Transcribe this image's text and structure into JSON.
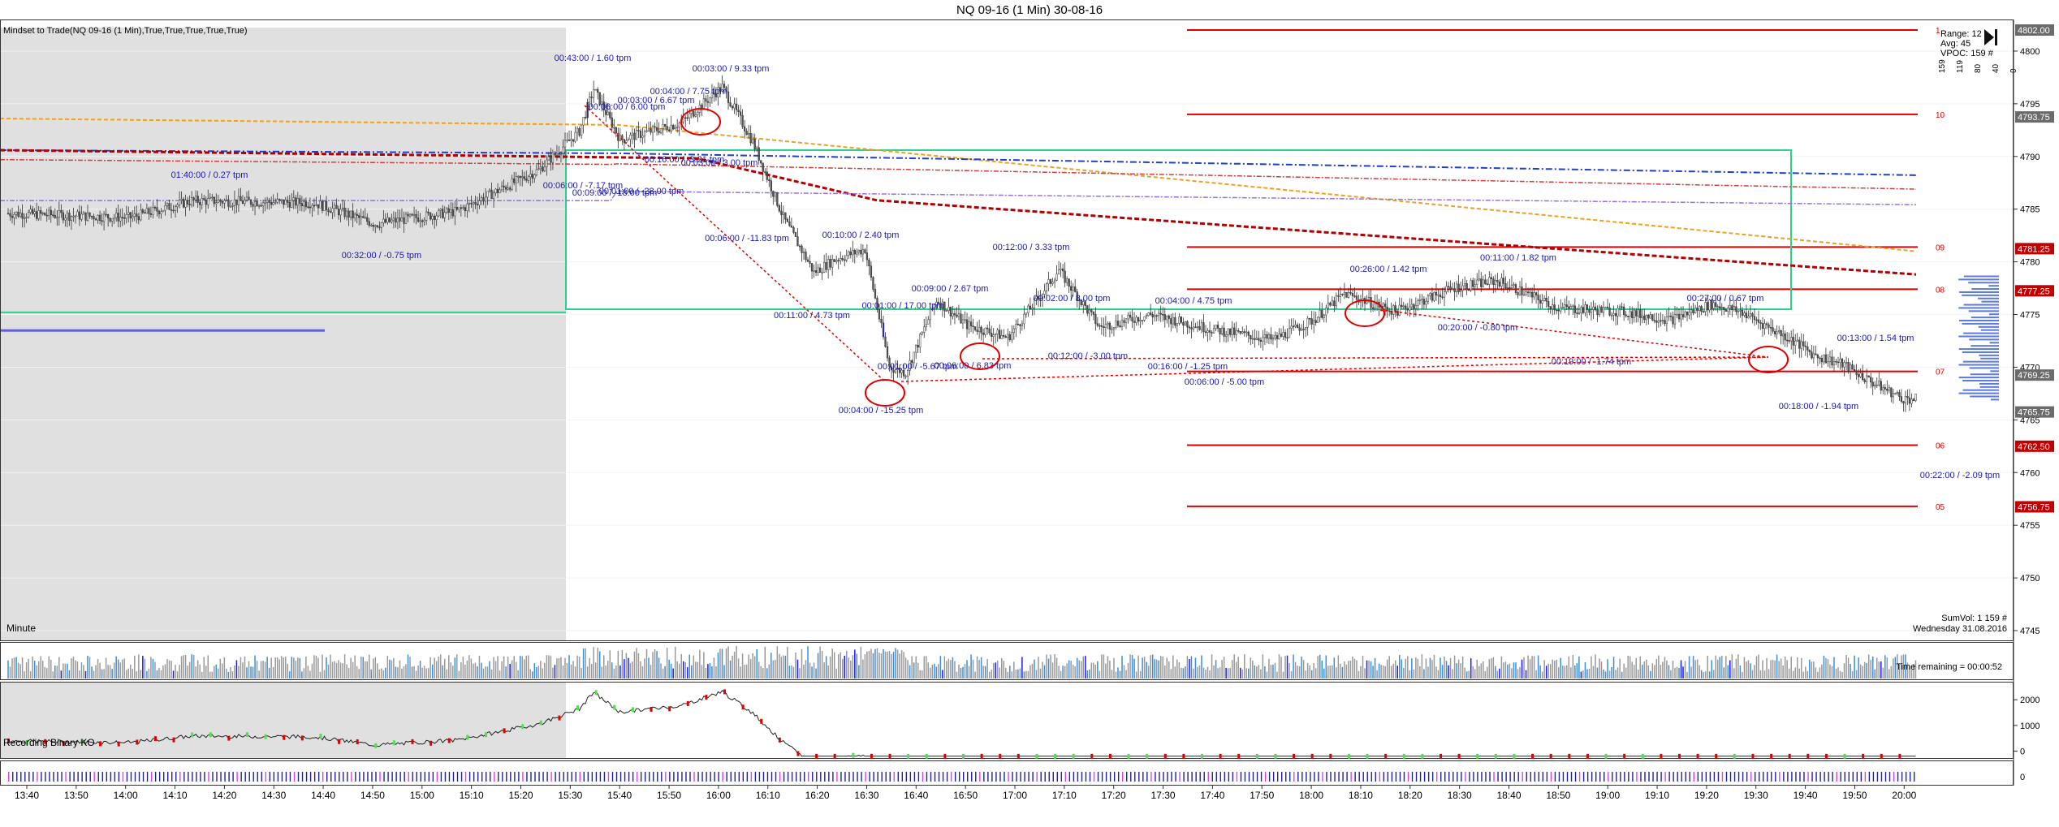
{
  "header": {
    "title": "NQ 09-16 (1 Min)  30-08-16"
  },
  "indicator_label": "Mindset to Trade(NQ 09-16 (1 Min),True,True,True,True,True)",
  "period_label": "Minute",
  "recording_label": "Recording Binary KO",
  "info_box": {
    "range": "Range: 12",
    "avg": "Avg:   45",
    "vpoc": "VPOC: 159 #"
  },
  "sumvol": "SumVol: 1 159 #",
  "date_label": "Wednesday  31.08.2016",
  "time_remaining": "Time remaining = 00:00:52",
  "volume_col_labels": [
    "159",
    "119",
    "80",
    "40",
    "0"
  ],
  "chart_data": [
    {
      "type": "candlestick",
      "title": "NQ 09-16 (1 Min)  30-08-16",
      "x_ticks": [
        "13:40",
        "13:50",
        "14:00",
        "14:10",
        "14:20",
        "14:30",
        "14:40",
        "14:50",
        "15:00",
        "15:10",
        "15:20",
        "15:30",
        "15:40",
        "15:50",
        "16:00",
        "16:10",
        "16:20",
        "16:30",
        "16:40",
        "16:50",
        "17:00",
        "17:10",
        "17:20",
        "17:30",
        "17:40",
        "17:50",
        "18:00",
        "18:10",
        "18:20",
        "18:30",
        "18:40",
        "18:50",
        "19:00",
        "19:10",
        "19:20",
        "19:30",
        "19:40",
        "19:50",
        "20:00"
      ],
      "y_ticks": [
        4800,
        4795,
        4790,
        4785,
        4780,
        4775,
        4770,
        4765,
        4760,
        4755,
        4750,
        4745
      ],
      "ylim": [
        4744,
        4803
      ],
      "price_badges": [
        {
          "label": "4802.00",
          "value": 4802.0,
          "color": "#6b6b6b"
        },
        {
          "label": "4793.75",
          "value": 4793.75,
          "color": "#6b6b6b"
        },
        {
          "label": "4781.25",
          "value": 4781.25,
          "color": "#c00000"
        },
        {
          "label": "4777.25",
          "value": 4777.25,
          "color": "#c00000"
        },
        {
          "label": "4769.25",
          "value": 4769.25,
          "color": "#6b6b6b"
        },
        {
          "label": "4765.75",
          "value": 4765.75,
          "color": "#6b6b6b"
        },
        {
          "label": "4762.50",
          "value": 4762.5,
          "color": "#c00000"
        },
        {
          "label": "4756.75",
          "value": 4756.75,
          "color": "#c00000"
        }
      ],
      "level_lines": [
        {
          "label": "1",
          "value": 4802.0
        },
        {
          "label": "10",
          "value": 4794.0
        },
        {
          "label": "09",
          "value": 4781.4
        },
        {
          "label": "08",
          "value": 4777.4
        },
        {
          "label": "07",
          "value": 4769.6
        },
        {
          "label": "06",
          "value": 4762.6
        },
        {
          "label": "05",
          "value": 4756.8
        }
      ],
      "annotations": [
        "00:43:00 / 1.60 tpm",
        "00:03:00 / 9.33 tpm",
        "00:04:00 / 7.75 tpm",
        "00:03:00 / 6.67 tpm",
        "00:06:00 / 6.00 tpm",
        "01:40:00 / 0.27 tpm",
        "00:06:00 / -7.17 tpm",
        "00:09:00 / -18.00 tpm",
        "00:16:00 / -3.31 tpm",
        "00:03:00 / 3.00 tpm",
        "00:01:00 / -28.00 tpm",
        "00:32:00 / -0.75 tpm",
        "00:06:00 / -11.83 tpm",
        "00:10:00 / 2.40 tpm",
        "00:11:00 / 4.73 tpm",
        "00:01:00 / 17.00 tpm",
        "00:09:00 / 2.67 tpm",
        "00:12:00 / 3.33 tpm",
        "00:01:00 / -5.67 tpm",
        "00:06:00 / 6.83 tpm",
        "00:04:00 / -15.25 tpm",
        "00:02:00 / 8.00 tpm",
        "00:12:00 / -3.00 tpm",
        "00:04:00 / 4.75 tpm",
        "00:16:00 / -1.25 tpm",
        "00:06:00 / -5.00 tpm",
        "00:26:00 / 1.42 tpm",
        "00:11:00 / 1.82 tpm",
        "00:20:00 / -0.80 tpm",
        "00:19:00 / -1.74 tpm",
        "00:27:00 / 0.67 tpm",
        "00:13:00 / 1.54 tpm",
        "00:18:00 / -1.94 tpm",
        "00:22:00 / -2.09 tpm"
      ]
    },
    {
      "type": "bar",
      "title": "",
      "name": "volume",
      "colors": {
        "up": "#3d8fd9",
        "down": "#9a9a9a",
        "high": "#1a1aff"
      }
    },
    {
      "type": "line",
      "title": "",
      "y_ticks": [
        2000,
        1000,
        0
      ],
      "ylim": [
        -300,
        2700
      ]
    },
    {
      "type": "bar",
      "title": "",
      "y_ticks": [
        0
      ]
    }
  ],
  "colors": {
    "session_bg": "#e0e0e0",
    "level_red": "#dd0000",
    "box_green": "#2fcf8f",
    "ma_orange": "#f0a020",
    "ma_blue": "#1f3fd0",
    "ma_darkred": "#b00000",
    "ma_violet": "#9a70e0",
    "label_blue": "#1a1aaa"
  }
}
